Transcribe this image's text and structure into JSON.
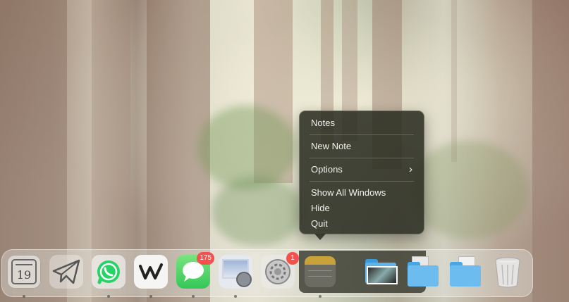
{
  "context_menu": {
    "items": [
      {
        "label": "Notes"
      },
      {
        "label": "New Note"
      },
      {
        "label": "Options",
        "has_submenu": true
      },
      {
        "label": "Show All Windows"
      },
      {
        "label": "Hide"
      },
      {
        "label": "Quit"
      }
    ],
    "submenu_arrow": "›"
  },
  "dock": {
    "calendar_day": "19",
    "messages_badge": "175",
    "settings_badge": "1",
    "apps": [
      {
        "name": "Calendar",
        "icon": "calendar-icon"
      },
      {
        "name": "Telegram",
        "icon": "paper-plane-icon"
      },
      {
        "name": "WhatsApp",
        "icon": "whatsapp-icon"
      },
      {
        "name": "Writer",
        "icon": "w-logo-icon"
      },
      {
        "name": "Messages",
        "icon": "speech-bubble-icon"
      },
      {
        "name": "Preview",
        "icon": "preview-icon"
      },
      {
        "name": "System Settings",
        "icon": "gear-icon"
      },
      {
        "name": "Notes",
        "icon": "notes-icon"
      },
      {
        "name": "Downloads",
        "icon": "folder-icon"
      },
      {
        "name": "Documents",
        "icon": "folder-icon"
      },
      {
        "name": "Folder",
        "icon": "folder-icon"
      },
      {
        "name": "Trash",
        "icon": "trash-icon"
      }
    ]
  },
  "colors": {
    "whatsapp": "#25d366",
    "messages": "#34c759",
    "badge": "#f2514d",
    "folder": "#5fb3ea",
    "notes_yellow": "#f5c542"
  }
}
